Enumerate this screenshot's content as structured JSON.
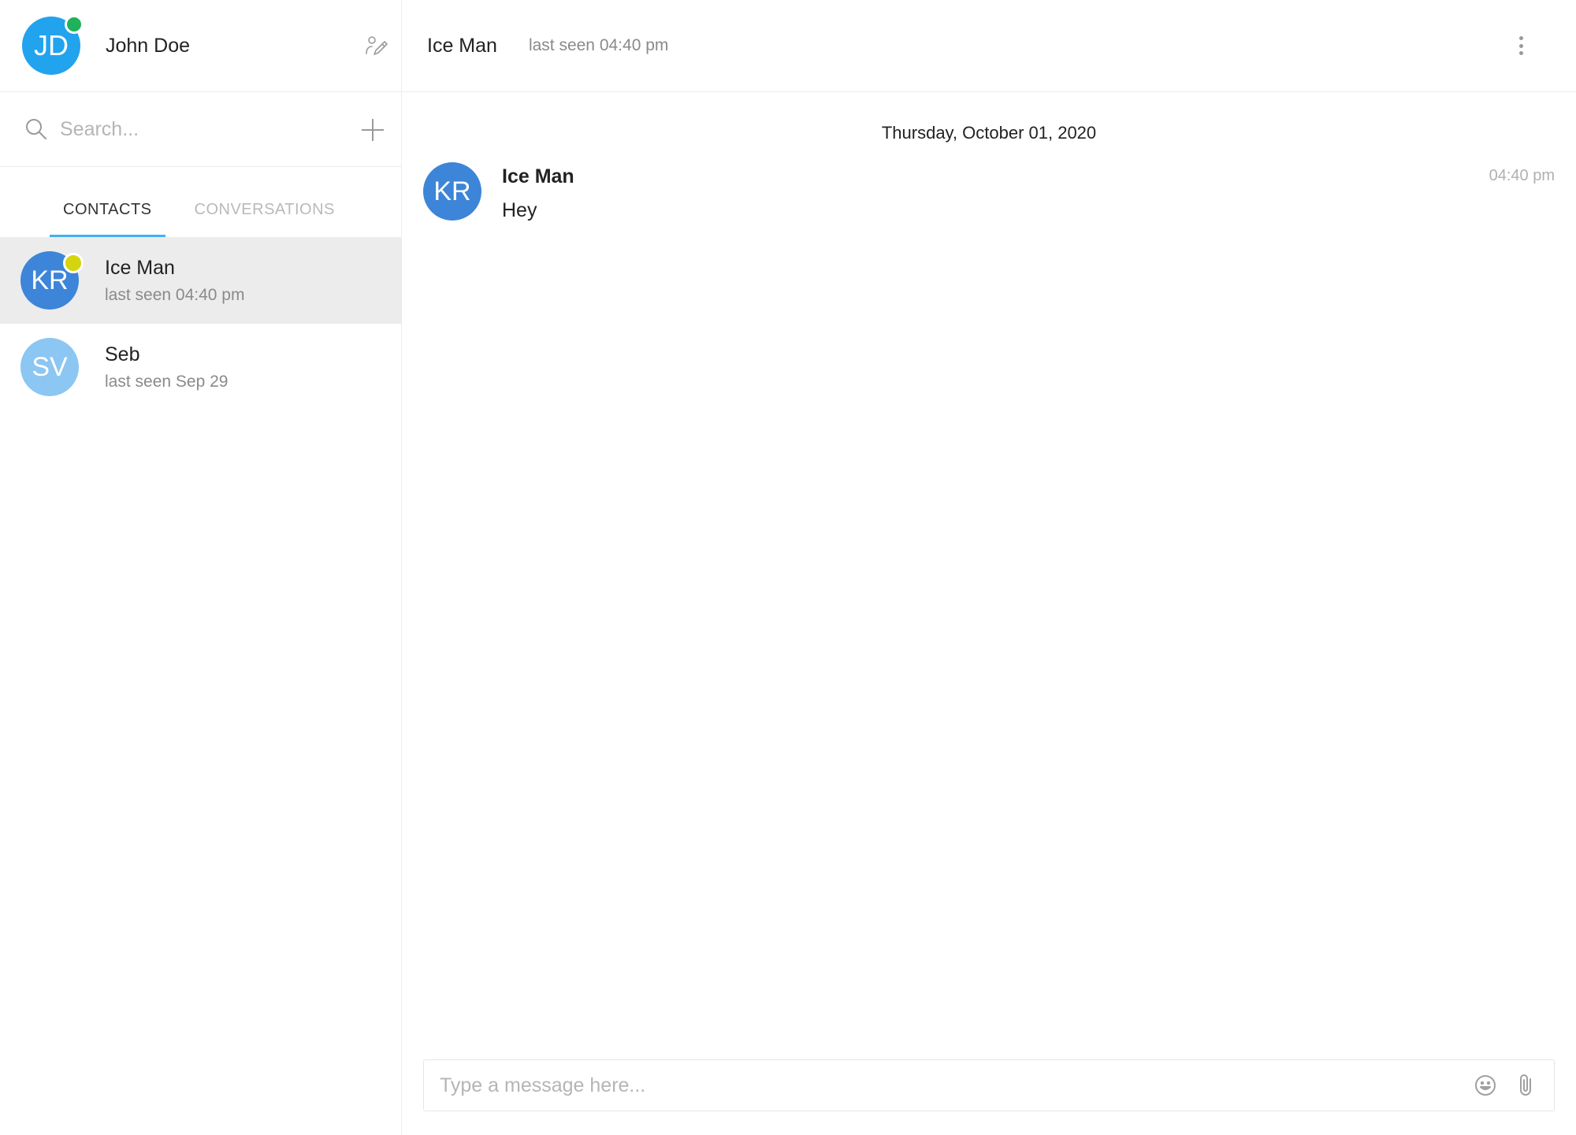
{
  "user": {
    "initials": "JD",
    "name": "John Doe",
    "avatar_color": "#21a3ee",
    "status_color": "#1fb25a",
    "edit_icon": "edit-profile-icon"
  },
  "search": {
    "placeholder": "Search...",
    "icon": "search-icon",
    "add_icon": "plus-icon"
  },
  "tabs": [
    {
      "label": "CONTACTS",
      "active": true
    },
    {
      "label": "CONVERSATIONS",
      "active": false
    }
  ],
  "contacts": [
    {
      "initials": "KR",
      "name": "Ice Man",
      "status": "last seen 04:40 pm",
      "avatar_color": "#3d85d8",
      "status_color": "#d4d40f",
      "selected": true
    },
    {
      "initials": "SV",
      "name": "Seb",
      "status": "last seen Sep 29",
      "avatar_color": "#8cc6f2",
      "selected": false
    }
  ],
  "chat": {
    "title": "Ice Man",
    "subtitle": "last seen 04:40 pm",
    "more_icon": "more-vertical-icon",
    "date_separator": "Thursday, October 01, 2020",
    "messages": [
      {
        "initials": "KR",
        "author": "Ice Man",
        "text": "Hey",
        "time": "04:40 pm",
        "avatar_color": "#3d85d8"
      }
    ],
    "composer": {
      "placeholder": "Type a message here...",
      "emoji_icon": "emoji-icon",
      "attach_icon": "paperclip-icon"
    }
  },
  "colors": {
    "accent": "#42b1f0",
    "selected_bg": "#ececec",
    "border": "#ececec"
  }
}
